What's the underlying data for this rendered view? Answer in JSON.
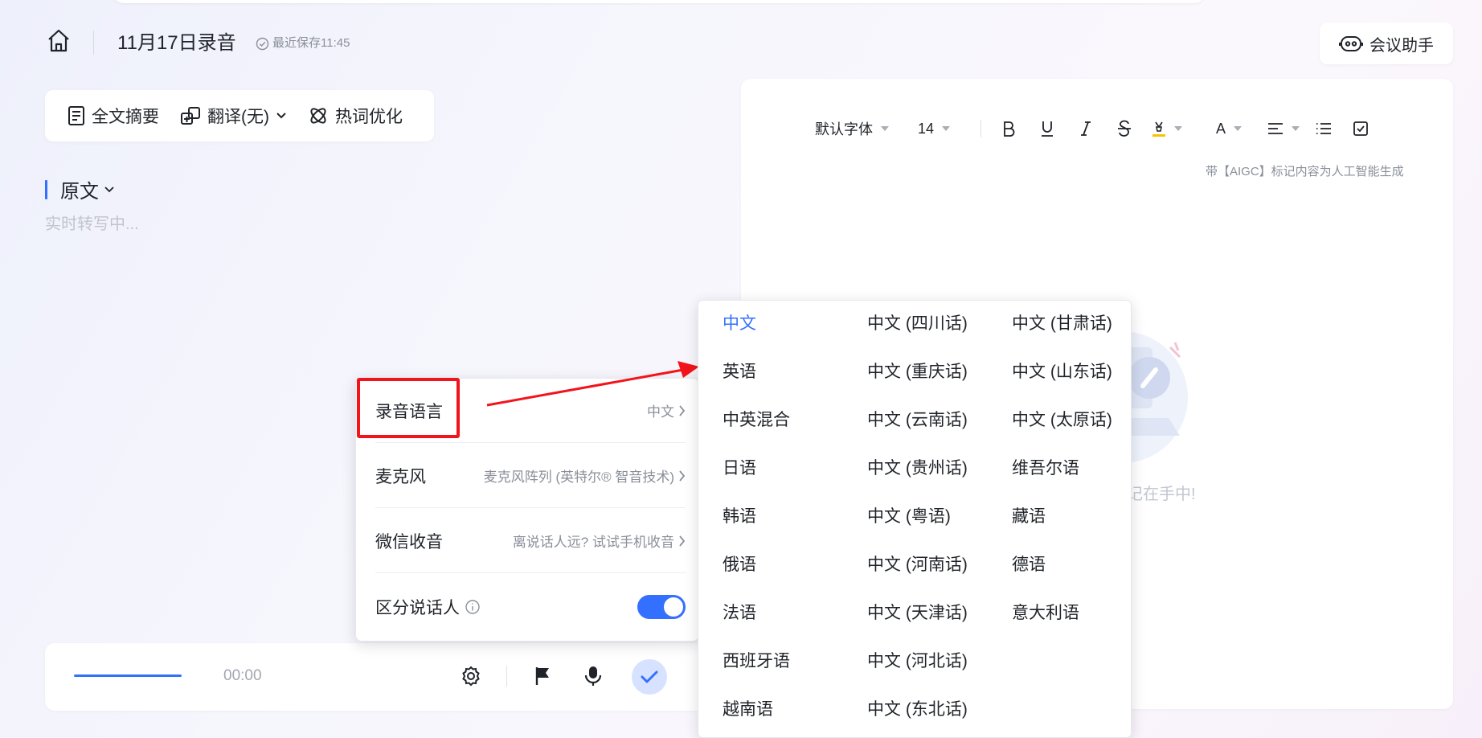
{
  "header": {
    "title": "11月17日录音",
    "save_status": "最近保存11:45",
    "assistant_label": "会议助手"
  },
  "toolbar": {
    "items": [
      {
        "label": "全文摘要",
        "icon": "document-icon"
      },
      {
        "label": "翻译(无)",
        "icon": "translate-icon"
      },
      {
        "label": "热词优化",
        "icon": "hotword-icon"
      }
    ]
  },
  "transcript": {
    "section_label": "原文",
    "placeholder": "实时转写中..."
  },
  "editor": {
    "font_family": "默认字体",
    "font_size": "14",
    "text_color_label": "A",
    "aigc_note": "带【AIGC】标记内容为人工智能生成",
    "empty_hint": "记在手中!"
  },
  "recorder": {
    "timer": "00:00"
  },
  "settings": {
    "rows": [
      {
        "label": "录音语言",
        "value": "中文"
      },
      {
        "label": "麦克风",
        "value": "麦克风阵列 (英特尔® 智音技术)"
      },
      {
        "label": "微信收音",
        "value": "离说话人远? 试试手机收音"
      },
      {
        "label": "区分说话人",
        "toggle": true
      }
    ]
  },
  "languages": {
    "selected": "中文",
    "columns": [
      [
        "中文",
        "英语",
        "中英混合",
        "日语",
        "韩语",
        "俄语",
        "法语",
        "西班牙语",
        "越南语"
      ],
      [
        "中文 (四川话)",
        "中文 (重庆话)",
        "中文 (云南话)",
        "中文 (贵州话)",
        "中文 (粤语)",
        "中文 (河南话)",
        "中文 (天津话)",
        "中文 (河北话)",
        "中文 (东北话)"
      ],
      [
        "中文 (甘肃话)",
        "中文 (山东话)",
        "中文 (太原话)",
        "维吾尔语",
        "藏语",
        "德语",
        "意大利语"
      ]
    ]
  },
  "colors": {
    "accent": "#3370ff",
    "annotation_red": "#f2141a"
  }
}
